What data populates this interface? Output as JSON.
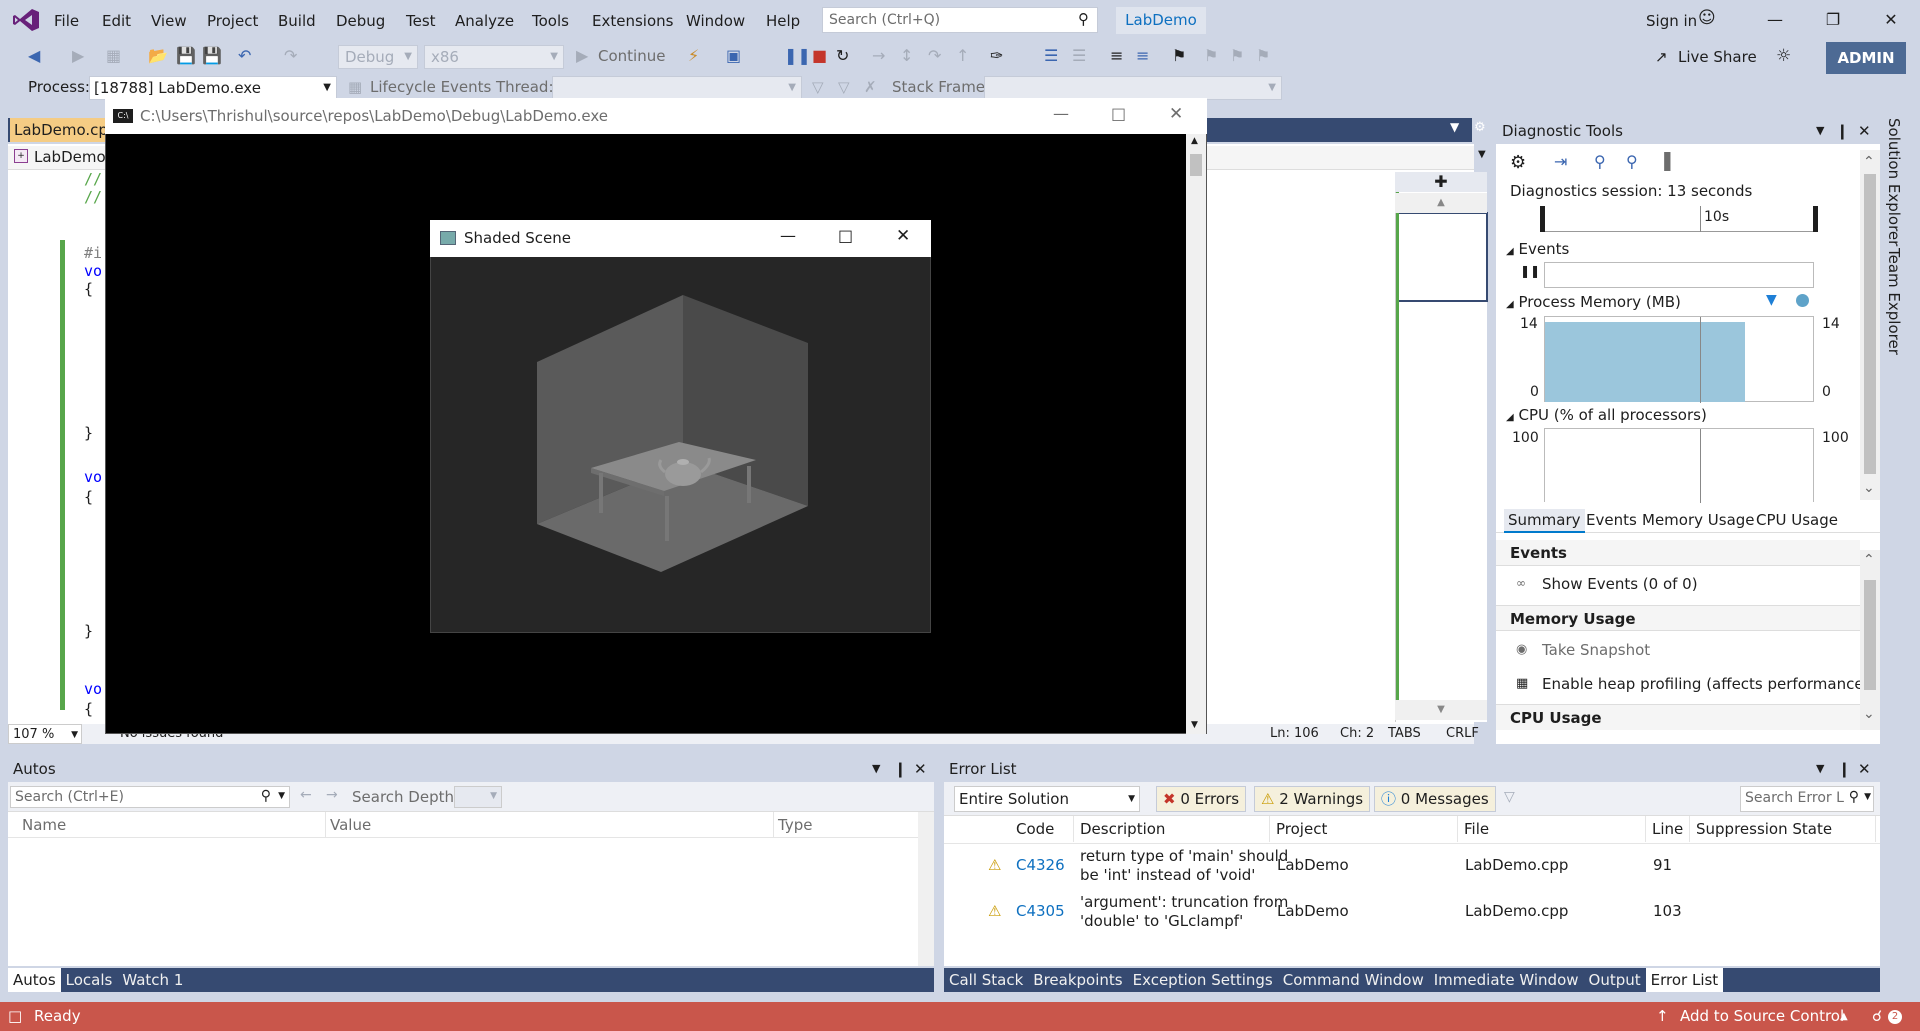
{
  "menu": [
    "File",
    "Edit",
    "View",
    "Project",
    "Build",
    "Debug",
    "Test",
    "Analyze",
    "Tools",
    "Extensions",
    "Window",
    "Help"
  ],
  "search": {
    "placeholder": "Search (Ctrl+Q)"
  },
  "solution_name": "LabDemo",
  "sign_in": "Sign in",
  "toolbar": {
    "config": "Debug",
    "platform": "x86",
    "continue_label": "Continue",
    "live_share": "Live Share",
    "admin": "ADMIN"
  },
  "debug_location": {
    "process_label": "Process:",
    "process_value": "[18788] LabDemo.exe",
    "lifecycle": "Lifecycle Events",
    "thread": "Thread:",
    "stack_frame": "Stack Frame:"
  },
  "editor": {
    "tab": "LabDemo.cpp",
    "nav_scope": "LabDemo",
    "lines": [
      "//",
      "//",
      "#i",
      "vo",
      "{",
      "}",
      "vo",
      "{",
      "}",
      "vo",
      "{"
    ],
    "zoom": "107 %",
    "issues": "No issues found",
    "ln": "Ln: 106",
    "ch": "Ch: 2",
    "tabs": "TABS",
    "crlf": "CRLF"
  },
  "console": {
    "title": "C:\\Users\\Thrishul\\source\\repos\\LabDemo\\Debug\\LabDemo.exe"
  },
  "glut": {
    "title": "Shaded Scene"
  },
  "diag": {
    "header": "Diagnostic Tools",
    "session": "Diagnostics session: 13 seconds",
    "timeline_tick": "10s",
    "events_label": "Events",
    "memory_label": "Process Memory (MB)",
    "memory_max": "14",
    "memory_min": "0",
    "cpu_label": "CPU (% of all processors)",
    "cpu_max": "100",
    "tabs": [
      "Summary",
      "Events",
      "Memory Usage",
      "CPU Usage"
    ],
    "summary_events": "Events",
    "show_events": "Show Events (0 of 0)",
    "memory_usage": "Memory Usage",
    "take_snapshot": "Take Snapshot",
    "heap_profiling": "Enable heap profiling (affects performance)",
    "cpu_usage": "CPU Usage"
  },
  "side_tabs": [
    "Solution Explorer",
    "Team Explorer"
  ],
  "autos": {
    "header": "Autos",
    "search_placeholder": "Search (Ctrl+E)",
    "search_depth": "Search Depth:",
    "columns": [
      "Name",
      "Value",
      "Type"
    ],
    "tabs": [
      "Autos",
      "Locals",
      "Watch 1"
    ]
  },
  "errors": {
    "header": "Error List",
    "scope": "Entire Solution",
    "errors_btn": "0 Errors",
    "warnings_btn": "2 Warnings",
    "messages_btn": "0 Messages",
    "search_placeholder": "Search Error L",
    "columns": [
      "Code",
      "Description",
      "Project",
      "File",
      "Line",
      "Suppression State"
    ],
    "rows": [
      {
        "code": "C4326",
        "desc1": "return type of 'main' should",
        "desc2": "be 'int' instead of 'void'",
        "project": "LabDemo",
        "file": "LabDemo.cpp",
        "line": "91"
      },
      {
        "code": "C4305",
        "desc1": "'argument': truncation from",
        "desc2": "'double' to 'GLclampf'",
        "project": "LabDemo",
        "file": "LabDemo.cpp",
        "line": "103"
      }
    ],
    "tabs": [
      "Call Stack",
      "Breakpoints",
      "Exception Settings",
      "Command Window",
      "Immediate Window",
      "Output",
      "Error List"
    ]
  },
  "status": {
    "ready": "Ready",
    "source_control": "Add to Source Control",
    "notifications": "2"
  }
}
